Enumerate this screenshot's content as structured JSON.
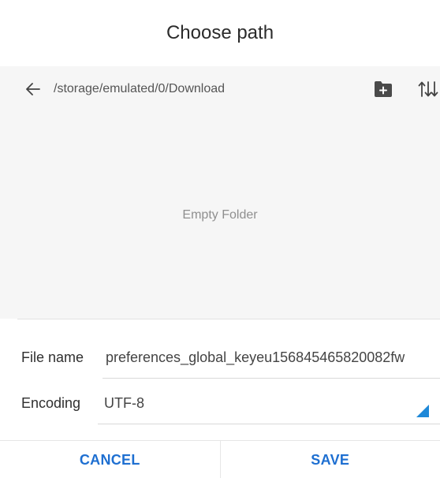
{
  "dialog": {
    "title": "Choose path"
  },
  "pathbar": {
    "current_path": "/storage/emulated/0/Download",
    "icons": {
      "back": "back-arrow-icon",
      "new_folder": "create-new-folder-icon",
      "sort": "sort-icon"
    }
  },
  "content": {
    "empty_message": "Empty Folder"
  },
  "form": {
    "file_name_label": "File name",
    "file_name_value": "preferences_global_keyeu156845465820082fw",
    "encoding_label": "Encoding",
    "encoding_value": "UTF-8"
  },
  "buttons": {
    "cancel_label": "CANCEL",
    "save_label": "SAVE"
  },
  "colors": {
    "accent": "#1e6fd1",
    "dropdown_indicator": "#1e88d8",
    "panel_background": "#f6f6f6",
    "folder_icon": "#4a4a4a"
  }
}
